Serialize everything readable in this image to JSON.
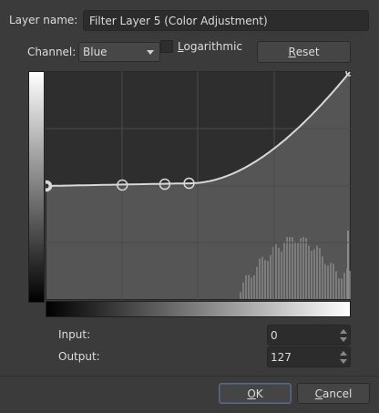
{
  "layer_name": {
    "label": "Layer name:",
    "value": "Filter Layer 5 (Color Adjustment)"
  },
  "channel": {
    "label": "Channel:",
    "selected": "Blue"
  },
  "logarithmic": {
    "label_underlined": "L",
    "label_rest": "ogarithmic",
    "checked": false
  },
  "reset_button": {
    "label_underlined": "R",
    "label_rest": "eset"
  },
  "curve": {
    "points": [
      [
        0,
        127
      ],
      [
        0.25,
        128
      ],
      [
        0.39,
        129
      ],
      [
        0.47,
        130
      ],
      [
        1.0,
        255
      ]
    ],
    "histogram_color": "#8a8a8a",
    "curve_color": "#d8d8d8"
  },
  "input": {
    "label": "Input:",
    "value": "0"
  },
  "output": {
    "label": "Output:",
    "value": "127"
  },
  "ok_button": {
    "label_underlined": "O",
    "label_rest": "K"
  },
  "cancel_button": {
    "label_underlined": "C",
    "label_rest": "ancel"
  }
}
